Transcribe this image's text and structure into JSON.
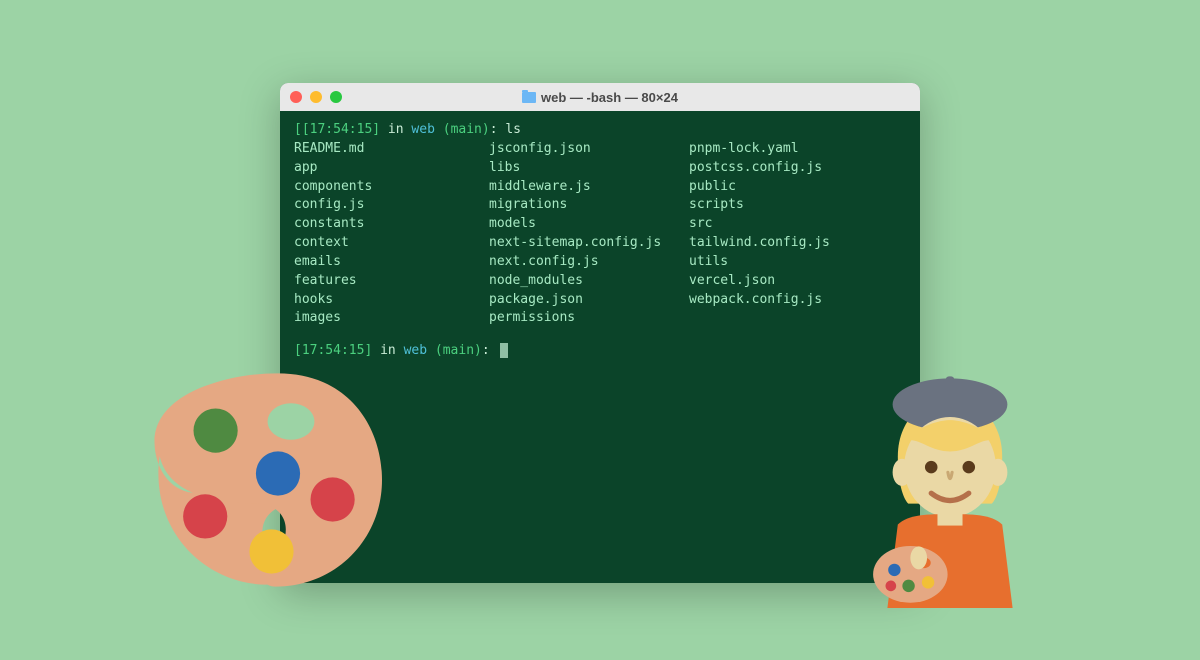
{
  "window": {
    "title": "web — -bash — 80×24"
  },
  "prompt1": {
    "open": "[[",
    "time": "17:54:15",
    "close_time": "]",
    "in": " in ",
    "dir": "web",
    "branch_open": " (",
    "branch": "main",
    "branch_close": ")",
    "sep": ": ",
    "cmd": "ls"
  },
  "ls": {
    "col1": [
      "README.md",
      "app",
      "components",
      "config.js",
      "constants",
      "context",
      "emails",
      "features",
      "hooks",
      "images"
    ],
    "col2": [
      "jsconfig.json",
      "libs",
      "middleware.js",
      "migrations",
      "models",
      "next-sitemap.config.js",
      "next.config.js",
      "node_modules",
      "package.json",
      "permissions"
    ],
    "col3": [
      "pnpm-lock.yaml",
      "postcss.config.js",
      "public",
      "scripts",
      "src",
      "tailwind.config.js",
      "utils",
      "vercel.json",
      "webpack.config.js",
      ""
    ]
  },
  "prompt2": {
    "open": "[",
    "time": "17:54:15",
    "close_time": "]",
    "in": " in ",
    "dir": "web",
    "branch_open": " (",
    "branch": "main",
    "branch_close": ")",
    "sep": ": "
  },
  "decor": {
    "palette": "palette-icon",
    "artist": "artist-icon"
  }
}
